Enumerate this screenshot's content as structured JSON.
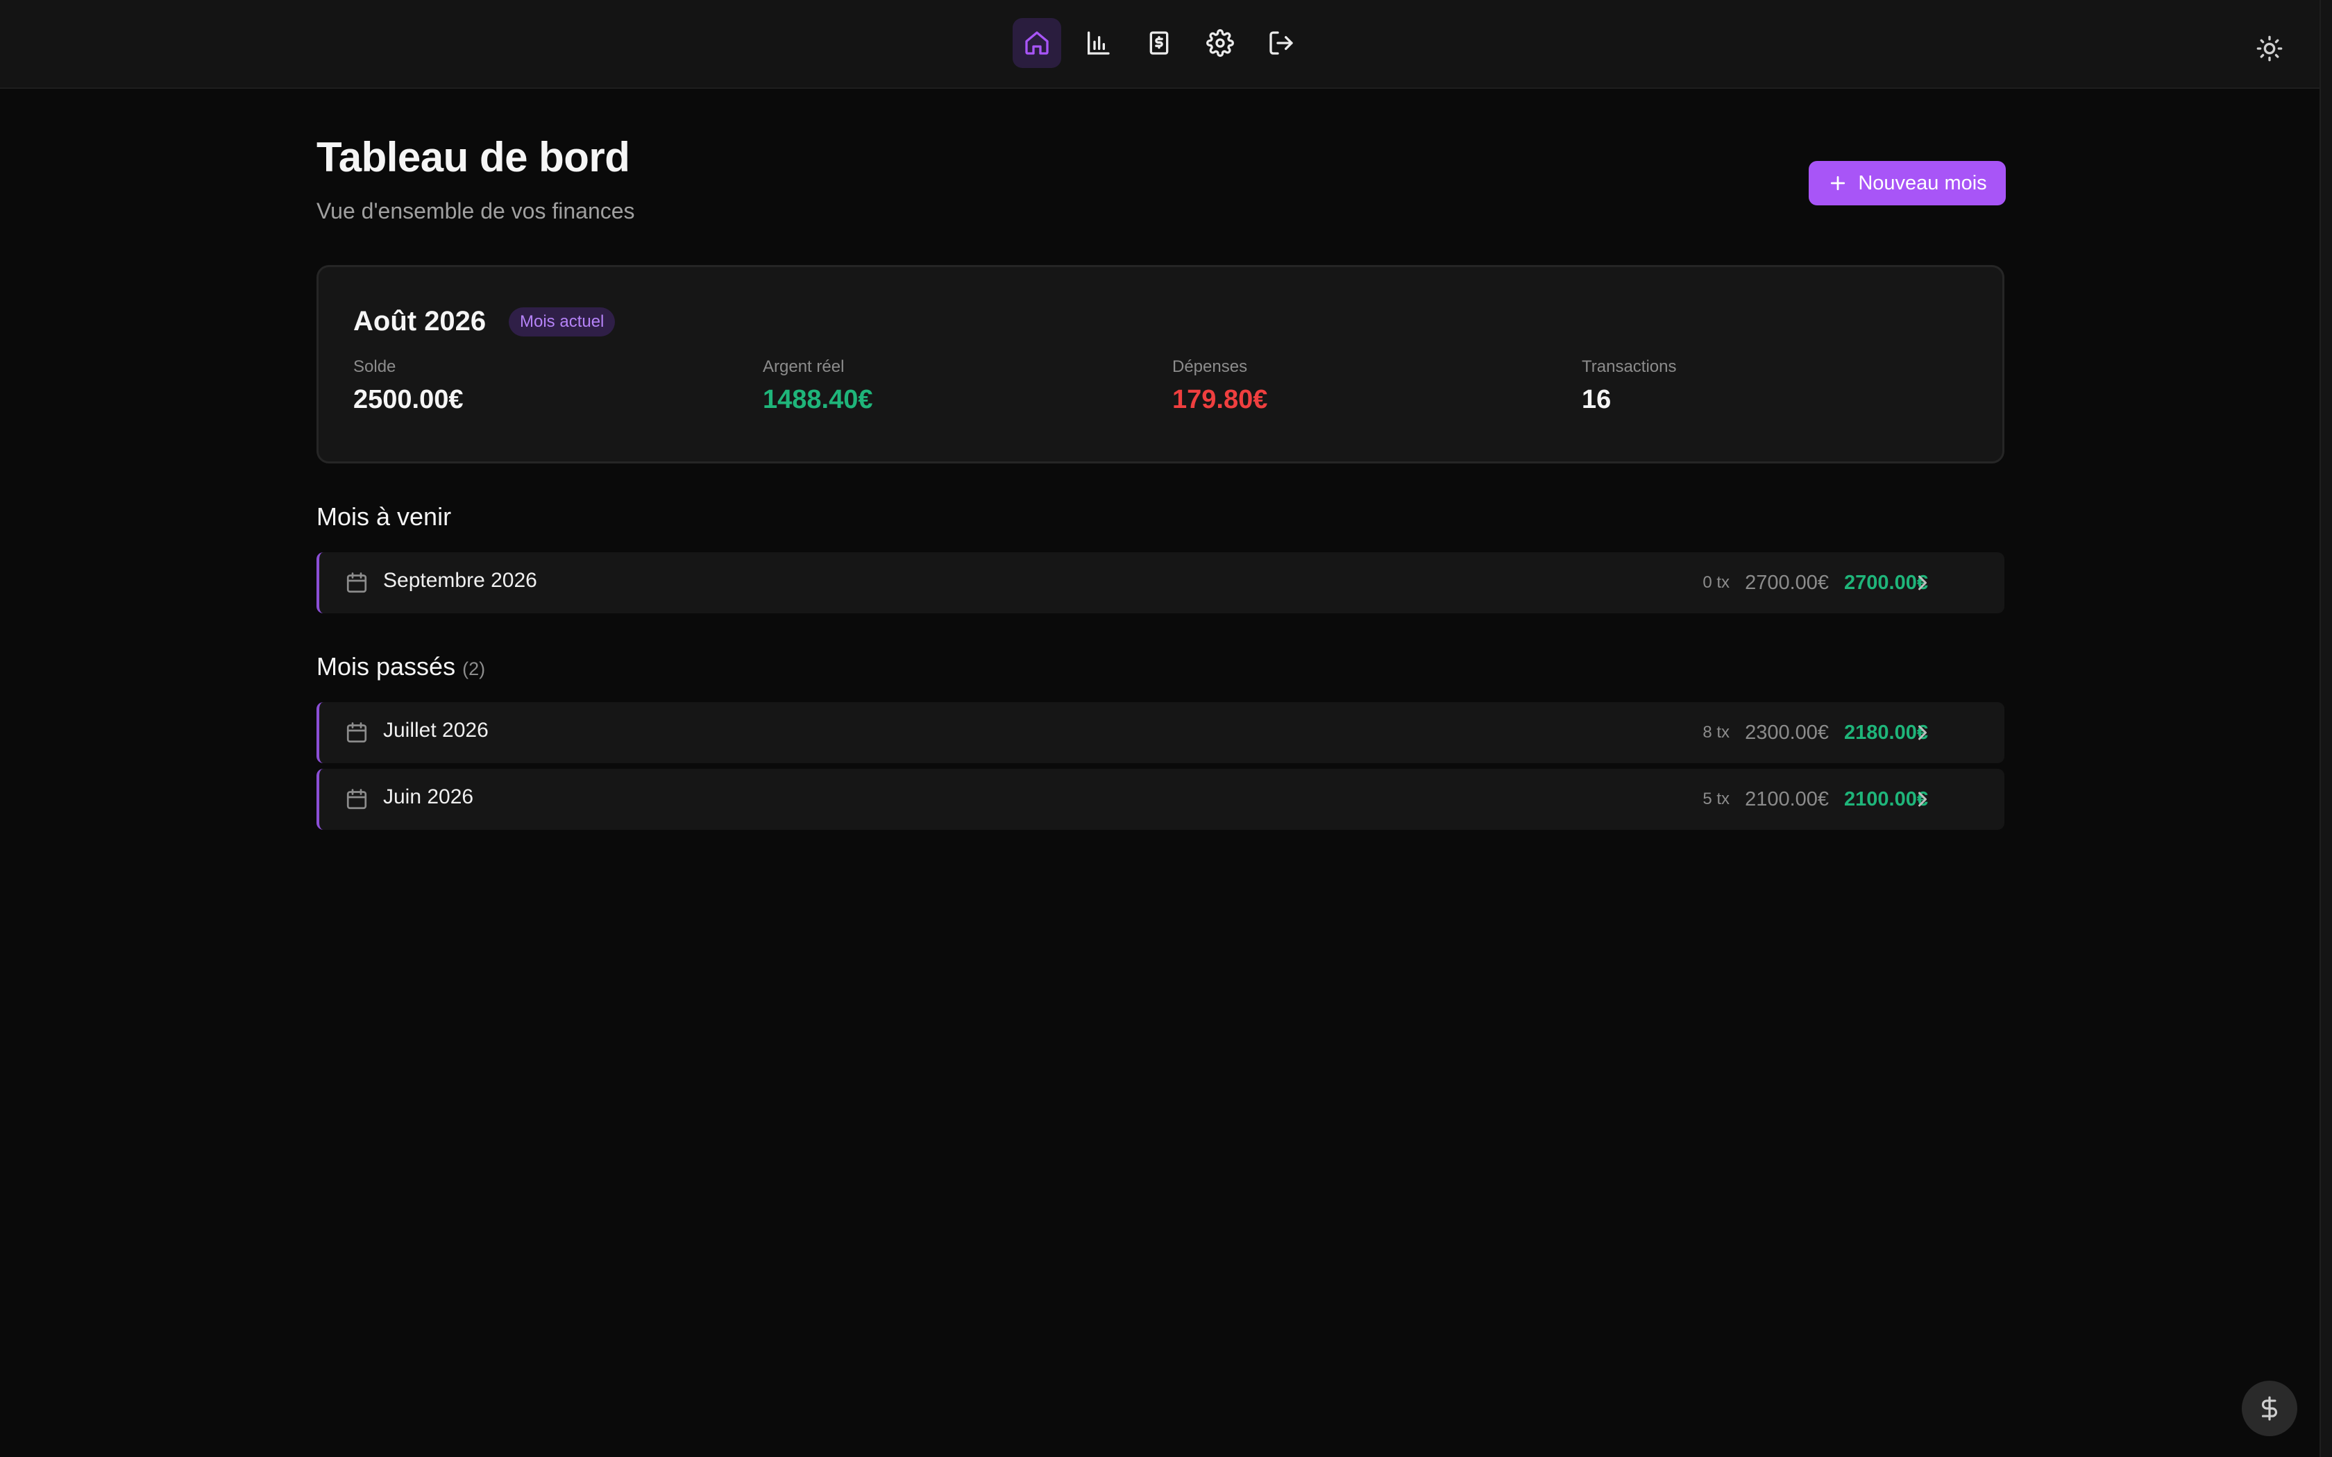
{
  "nav": {
    "items": [
      {
        "name": "nav-home",
        "icon": "home-icon",
        "active": true
      },
      {
        "name": "nav-statistics",
        "icon": "bar-chart-icon",
        "active": false
      },
      {
        "name": "nav-receipts",
        "icon": "receipt-dollar-icon",
        "active": false
      },
      {
        "name": "nav-settings",
        "icon": "gear-icon",
        "active": false
      },
      {
        "name": "nav-logout",
        "icon": "logout-icon",
        "active": false
      }
    ],
    "theme_toggle_icon": "sun-icon"
  },
  "header": {
    "title": "Tableau de bord",
    "subtitle": "Vue d'ensemble de vos finances",
    "new_month_label": "Nouveau mois"
  },
  "current_month": {
    "title": "Août 2026",
    "badge": "Mois actuel",
    "stats": [
      {
        "label": "Solde",
        "value": "2500.00€",
        "color": "#f5f5f5"
      },
      {
        "label": "Argent réel",
        "value": "1488.40€",
        "color": "#1fb57a"
      },
      {
        "label": "Dépenses",
        "value": "179.80€",
        "color": "#ef3f3f"
      },
      {
        "label": "Transactions",
        "value": "16",
        "color": "#f5f5f5"
      }
    ]
  },
  "upcoming": {
    "title": "Mois à venir",
    "rows": [
      {
        "label": "Septembre 2026",
        "tx": "0 tx",
        "total": "2700.00€",
        "real": "2700.00€"
      }
    ]
  },
  "past": {
    "title": "Mois passés",
    "count": "(2)",
    "rows": [
      {
        "label": "Juillet 2026",
        "tx": "8 tx",
        "total": "2300.00€",
        "real": "2180.00€"
      },
      {
        "label": "Juin 2026",
        "tx": "5 tx",
        "total": "2100.00€",
        "real": "2100.00€"
      }
    ]
  },
  "fab_icon": "dollar-icon",
  "colors": {
    "accent": "#a855f7",
    "positive": "#1fb57a",
    "negative": "#ef3f3f",
    "background": "#0a0a0a"
  }
}
